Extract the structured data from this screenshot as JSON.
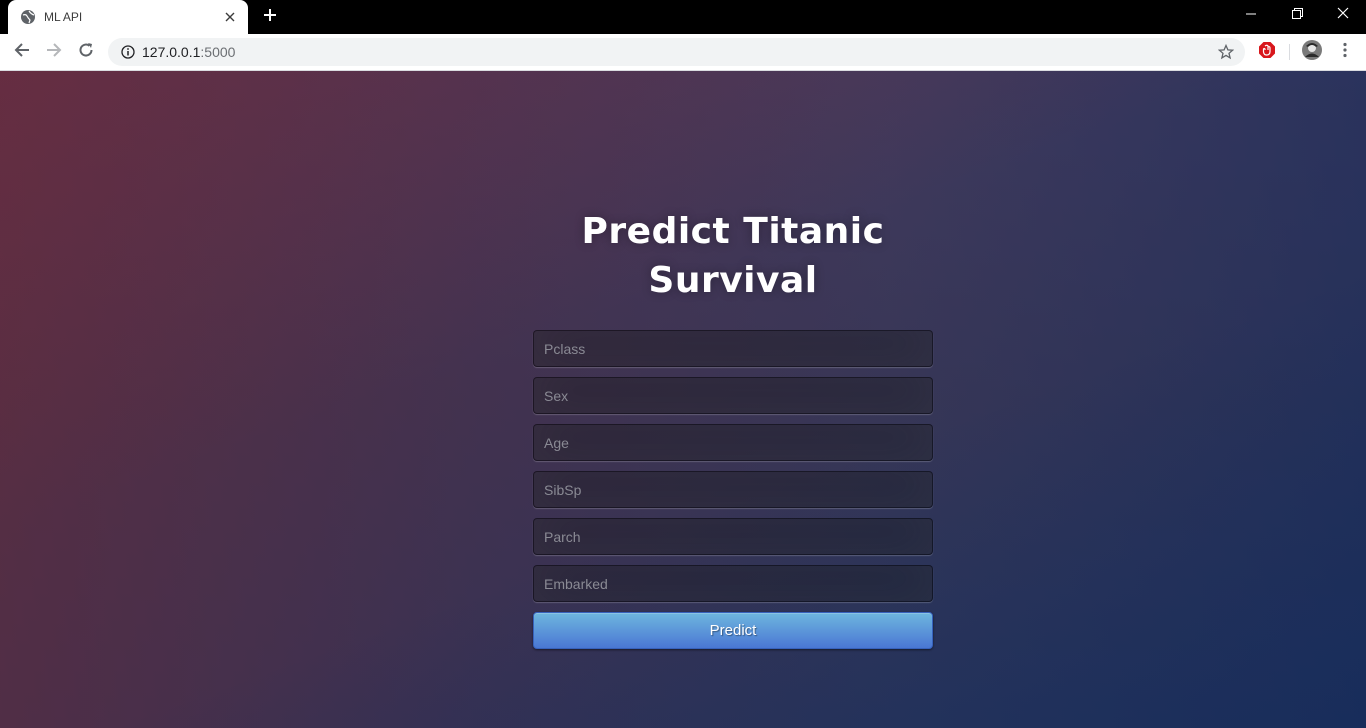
{
  "browser": {
    "tab": {
      "title": "ML API",
      "favicon": "globe-icon",
      "close_icon": "close-icon"
    },
    "new_tab_icon": "plus-icon",
    "window_controls": [
      "minimize-icon",
      "restore-icon",
      "close-icon"
    ],
    "address": {
      "host": "127.0.0.1",
      "port": ":5000",
      "info_icon": "info-icon",
      "bookmark_icon": "star-icon"
    },
    "extensions": [
      "adblock-icon",
      "profile-avatar",
      "menu-icon"
    ]
  },
  "page": {
    "heading": "Predict Titanic Survival",
    "fields": [
      {
        "name": "pclass",
        "placeholder": "Pclass",
        "value": ""
      },
      {
        "name": "sex",
        "placeholder": "Sex",
        "value": ""
      },
      {
        "name": "age",
        "placeholder": "Age",
        "value": ""
      },
      {
        "name": "sibsp",
        "placeholder": "SibSp",
        "value": ""
      },
      {
        "name": "parch",
        "placeholder": "Parch",
        "value": ""
      },
      {
        "name": "embarked",
        "placeholder": "Embarked",
        "value": ""
      }
    ],
    "submit_label": "Predict",
    "colors": {
      "button_top": "#6eb6de",
      "button_bottom": "#4a77d4"
    }
  }
}
